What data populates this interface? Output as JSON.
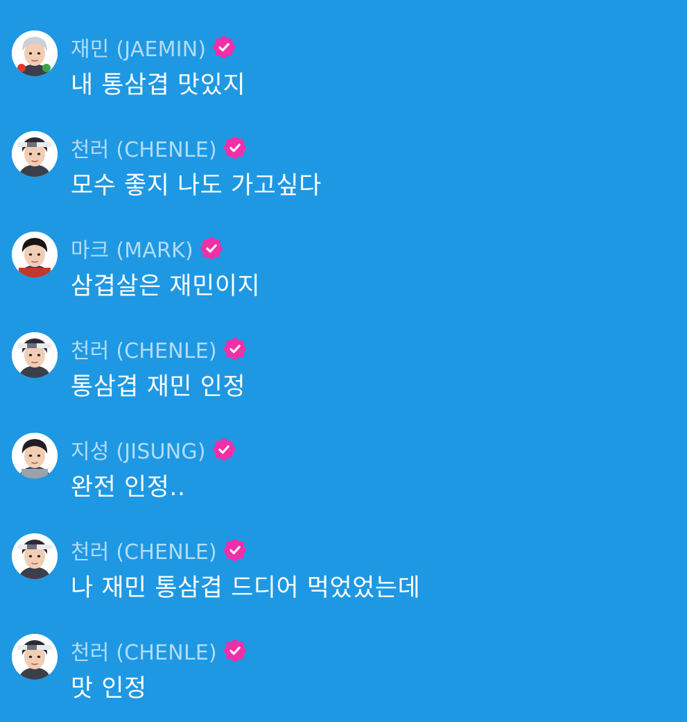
{
  "badge": {
    "name": "verified-badge-icon",
    "color": "#f12fa9",
    "check_color": "#ffffff"
  },
  "messages": [
    {
      "name": "재민 (JAEMIN)",
      "text": "내 통삼겹 맛있지",
      "avatar": "jaemin-avatar",
      "hair": "#cdd0d6"
    },
    {
      "name": "천러 (CHENLE)",
      "text": "모수 좋지 나도 가고싶다",
      "avatar": "chenle-avatar",
      "hair": "#2b2a36"
    },
    {
      "name": "마크 (MARK)",
      "text": "삼겹살은 재민이지",
      "avatar": "mark-avatar",
      "hair": "#1a1414"
    },
    {
      "name": "천러 (CHENLE)",
      "text": "통삼겹 재민 인정",
      "avatar": "chenle-avatar",
      "hair": "#2b2a36"
    },
    {
      "name": "지성 (JISUNG)",
      "text": "완전 인정..",
      "avatar": "jisung-avatar",
      "hair": "#231c24"
    },
    {
      "name": "천러 (CHENLE)",
      "text": "나 재민 통삼겹 드디어 먹었었는데",
      "avatar": "chenle-avatar",
      "hair": "#2b2a36"
    },
    {
      "name": "천러 (CHENLE)",
      "text": "맛 인정",
      "avatar": "chenle-avatar",
      "hair": "#2b2a36"
    }
  ]
}
